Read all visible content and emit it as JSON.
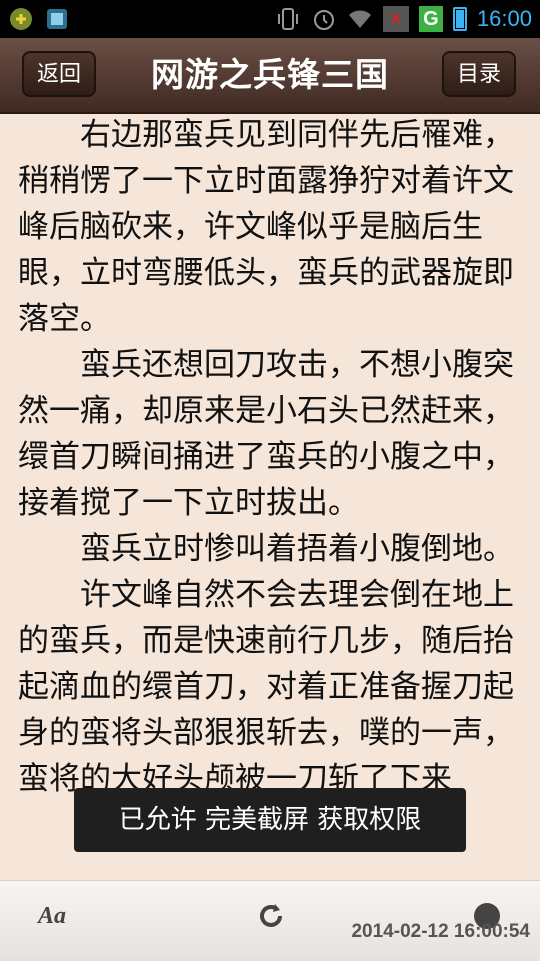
{
  "status_bar": {
    "time": "16:00",
    "network_type": "G"
  },
  "title_bar": {
    "back_label": "返回",
    "title": "网游之兵锋三国",
    "menu_label": "目录"
  },
  "content": {
    "paragraphs": [
      "右边那蛮兵见到同伴先后罹难，稍稍愣了一下立时面露狰狞对着许文峰后脑砍来，许文峰似乎是脑后生眼，立时弯腰低头，蛮兵的武器旋即落空。",
      "蛮兵还想回刀攻击，不想小腹突然一痛，却原来是小石头已然赶来，缳首刀瞬间捅进了蛮兵的小腹之中，接着搅了一下立时拔出。",
      "蛮兵立时惨叫着捂着小腹倒地。",
      "许文峰自然不会去理会倒在地上的蛮兵，而是快速前行几步，随后抬起滴血的缳首刀，对着正准备握刀起身的蛮将头部狠狠斩去，噗的一声，蛮将的大好头颅被一刀斩了下来"
    ]
  },
  "toast": {
    "message": "已允许 完美截屏 获取权限"
  },
  "bottom_bar": {
    "font_label": "Aa",
    "timestamp": "2014-02-12 16:00:54"
  }
}
